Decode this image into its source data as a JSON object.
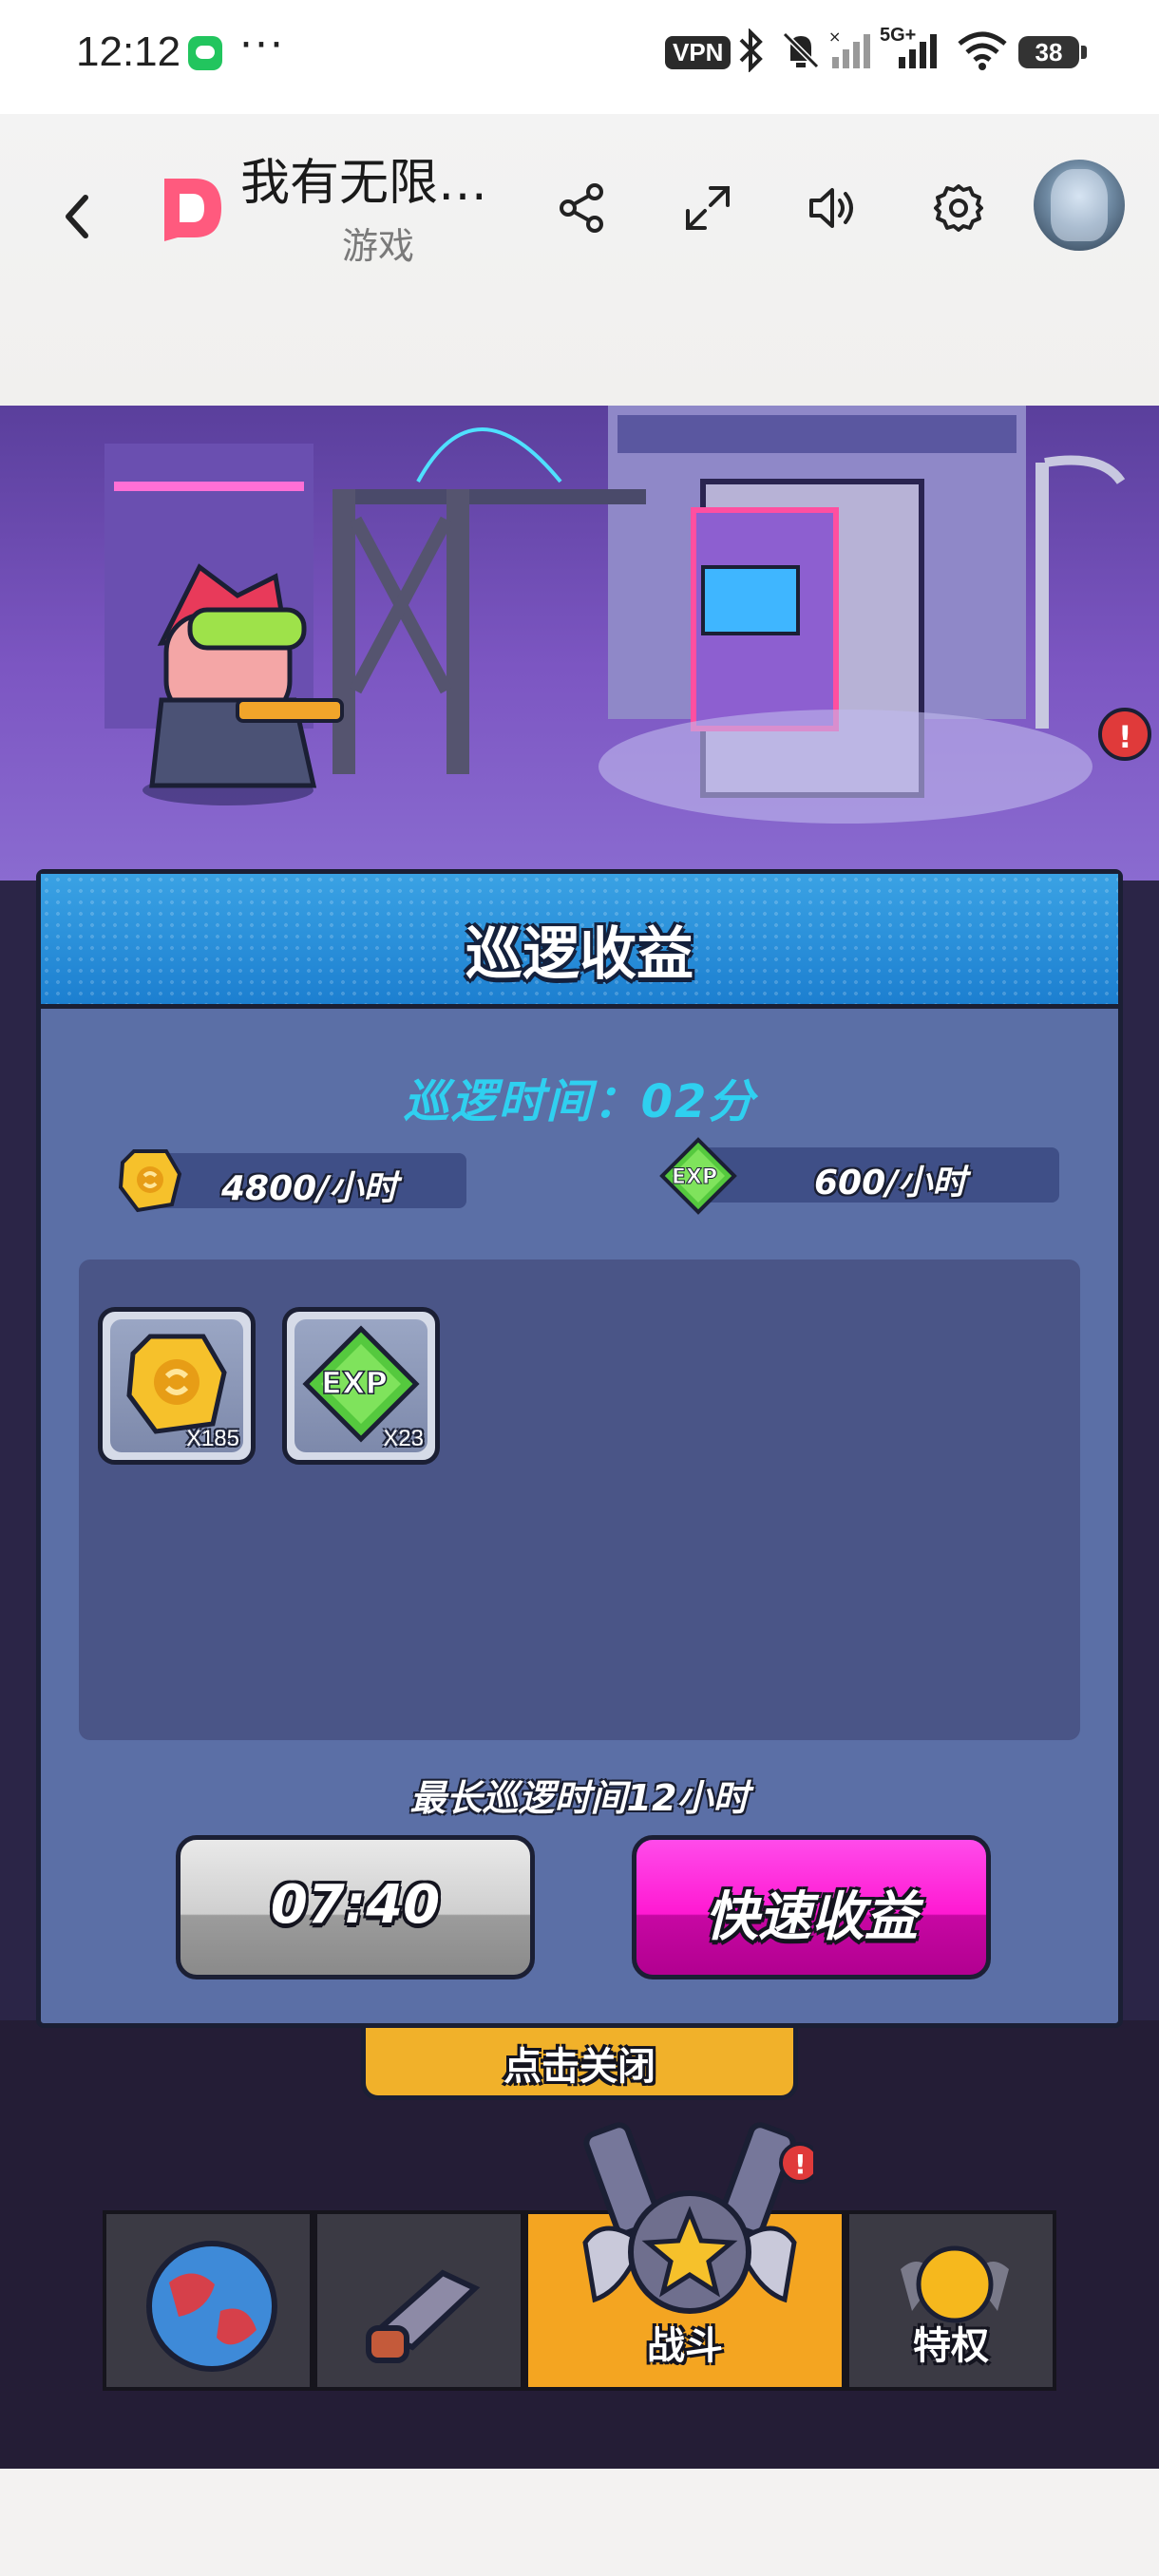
{
  "status_bar": {
    "time": "12:12",
    "more": "···",
    "vpn": "VPN",
    "network": "5G+",
    "battery": "38"
  },
  "header": {
    "title": "我有无限…",
    "subtitle": "游戏"
  },
  "dialog": {
    "title": "巡逻收益",
    "patrol_time": "巡逻时间：02分",
    "gold_rate": "4800/小时",
    "exp_rate": "600/小时",
    "rewards": [
      {
        "icon": "gold-coin-icon",
        "qty": "X185"
      },
      {
        "icon": "exp-gem-icon",
        "qty": "X23"
      }
    ],
    "max_time_note": "最长巡逻时间12小时",
    "timer": "07:40",
    "quick_collect": "快速收益"
  },
  "close_hint": "点击关闭",
  "bottom_nav": {
    "tabs": [
      "",
      "",
      "战斗",
      "特权"
    ]
  },
  "colors": {
    "dialog_bg": "#5b6fa6",
    "header_blue": "#1c7fd0",
    "patrol_cyan": "#2fd0f0",
    "pink_button": "#ff19d2"
  }
}
